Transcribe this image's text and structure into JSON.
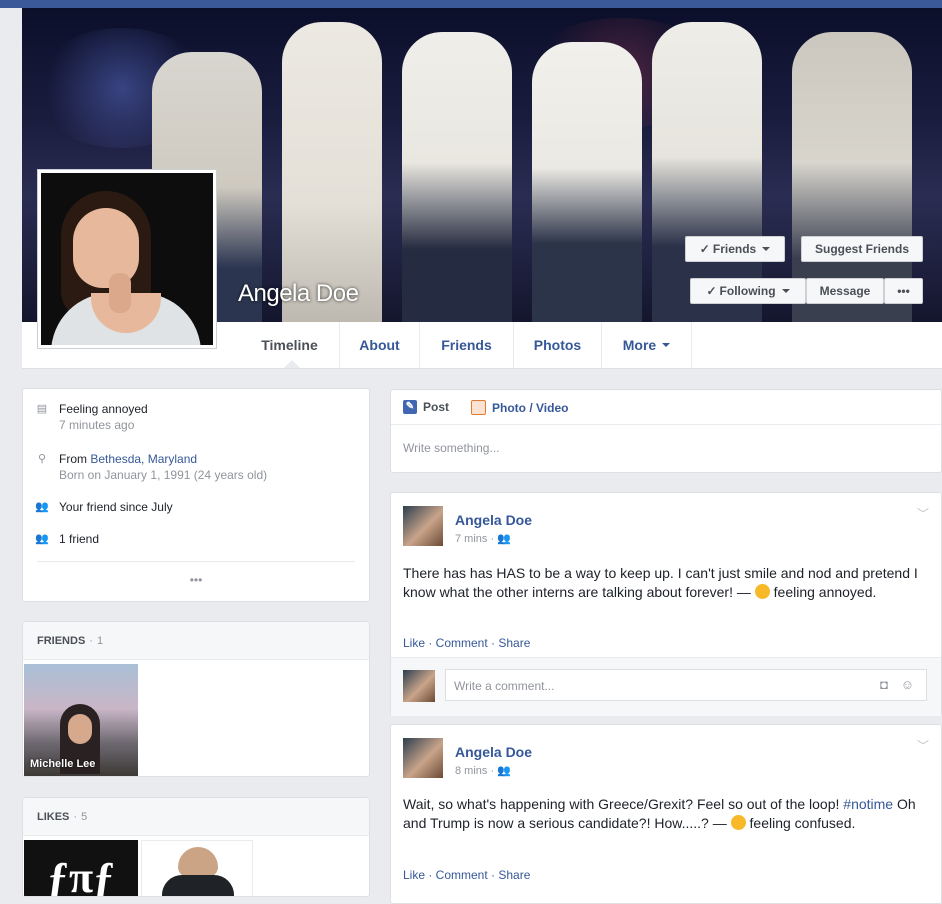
{
  "profile": {
    "name": "Angela Doe",
    "buttons": {
      "friends": "Friends",
      "suggest_friends": "Suggest Friends",
      "following": "Following",
      "message": "Message",
      "more": "•••"
    }
  },
  "tabs": [
    {
      "label": "Timeline",
      "active": true
    },
    {
      "label": "About"
    },
    {
      "label": "Friends"
    },
    {
      "label": "Photos"
    },
    {
      "label": "More"
    }
  ],
  "intro": {
    "feeling": "Feeling annoyed",
    "feeling_time": "7 minutes ago",
    "from_prefix": "From",
    "from_place": "Bethesda, Maryland",
    "born": "Born on January 1, 1991 (24 years old)",
    "friend_since": "Your friend since July",
    "friend_count": "1 friend",
    "more": "•••"
  },
  "friends_card": {
    "title": "FRIENDS",
    "count": "1",
    "friend_name": "Michelle Lee"
  },
  "likes_card": {
    "title": "LIKES",
    "count": "5"
  },
  "composer": {
    "post_tab": "Post",
    "photo_tab": "Photo / Video",
    "placeholder": "Write something..."
  },
  "posts": [
    {
      "author": "Angela Doe",
      "meta": "7 mins ·",
      "text_main": "There has has HAS to be a way to keep up. I can't just smile and nod and pretend I know what the other interns are talking about forever! —",
      "feeling": "feeling annoyed.",
      "actions": "Like · Comment · Share",
      "comment_placeholder": "Write a comment..."
    },
    {
      "author": "Angela Doe",
      "meta": "8 mins ·",
      "text_before": "Wait, so what's happening with Greece/Grexit? Feel so out of the loop!",
      "hashtag": "#notime",
      "text_after": "Oh and Trump is now a serious candidate?! How.....? —",
      "feeling": "feeling confused.",
      "actions": "Like · Comment · Share"
    }
  ]
}
